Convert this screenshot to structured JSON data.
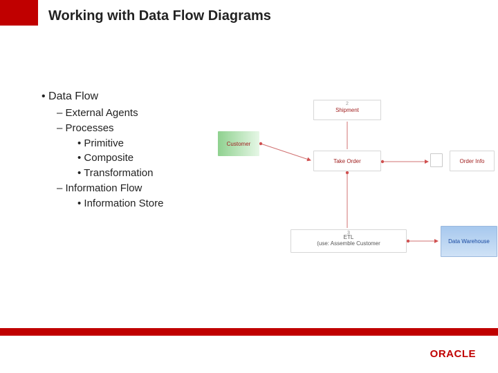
{
  "title": "Working with Data Flow Diagrams",
  "bullets": {
    "l1": "Data Flow",
    "l2a": "External Agents",
    "l2b": "Processes",
    "l3a": "Primitive",
    "l3b": "Composite",
    "l3c": "Transformation",
    "l2c": "Information Flow",
    "l3d": "Information Store"
  },
  "diagram": {
    "customer": "Customer",
    "shipment_num": "2",
    "shipment": "Shipment",
    "takeorder": "Take Order",
    "orderinfo": "Order Info",
    "etl_num": "3",
    "etl_line1": "ETL",
    "etl_line2": "(use: Assemble Customer",
    "datawarehouse": "Data Warehouse"
  },
  "footer": {
    "logo": "ORACLE"
  }
}
